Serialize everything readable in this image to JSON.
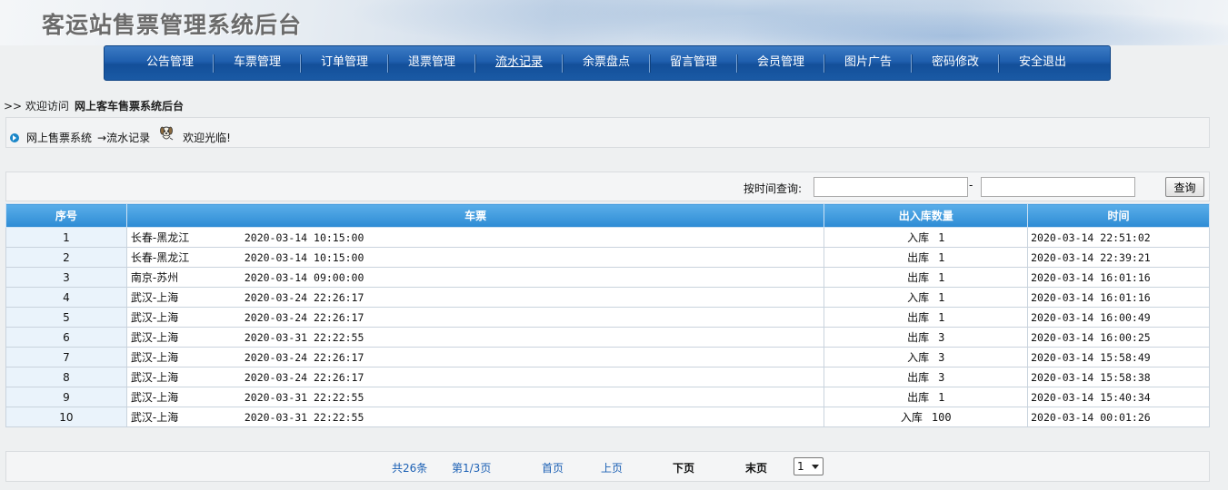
{
  "header": {
    "title": "客运站售票管理系统后台"
  },
  "nav": {
    "items": [
      {
        "label": "公告管理"
      },
      {
        "label": "车票管理"
      },
      {
        "label": "订单管理"
      },
      {
        "label": "退票管理"
      },
      {
        "label": "流水记录"
      },
      {
        "label": "余票盘点"
      },
      {
        "label": "留言管理"
      },
      {
        "label": "会员管理"
      },
      {
        "label": "图片广告"
      },
      {
        "label": "密码修改"
      },
      {
        "label": "安全退出"
      }
    ],
    "active_index": 4
  },
  "welcome": {
    "prefix": ">>  欢迎访问",
    "site_name": "网上客车售票系统后台"
  },
  "breadcrumb": {
    "home": "网上售票系统",
    "current": "→流水记录",
    "greeting": "欢迎光临!"
  },
  "search": {
    "label": "按时间查询:",
    "separator": "-",
    "start_value": "",
    "end_value": "",
    "button": "查询"
  },
  "table": {
    "headers": [
      "序号",
      "车票",
      "出入库数量",
      "时间"
    ],
    "rows": [
      {
        "no": "1",
        "route": "长春-黑龙江",
        "depart": "2020-03-14 10:15:00",
        "type": "入库",
        "qty": "1",
        "time": "2020-03-14 22:51:02"
      },
      {
        "no": "2",
        "route": "长春-黑龙江",
        "depart": "2020-03-14 10:15:00",
        "type": "出库",
        "qty": "1",
        "time": "2020-03-14 22:39:21"
      },
      {
        "no": "3",
        "route": "南京-苏州",
        "depart": "2020-03-14 09:00:00",
        "type": "出库",
        "qty": "1",
        "time": "2020-03-14 16:01:16"
      },
      {
        "no": "4",
        "route": "武汉-上海",
        "depart": "2020-03-24 22:26:17",
        "type": "入库",
        "qty": "1",
        "time": "2020-03-14 16:01:16"
      },
      {
        "no": "5",
        "route": "武汉-上海",
        "depart": "2020-03-24 22:26:17",
        "type": "出库",
        "qty": "1",
        "time": "2020-03-14 16:00:49"
      },
      {
        "no": "6",
        "route": "武汉-上海",
        "depart": "2020-03-31 22:22:55",
        "type": "出库",
        "qty": "3",
        "time": "2020-03-14 16:00:25"
      },
      {
        "no": "7",
        "route": "武汉-上海",
        "depart": "2020-03-24 22:26:17",
        "type": "入库",
        "qty": "3",
        "time": "2020-03-14 15:58:49"
      },
      {
        "no": "8",
        "route": "武汉-上海",
        "depart": "2020-03-24 22:26:17",
        "type": "出库",
        "qty": "3",
        "time": "2020-03-14 15:58:38"
      },
      {
        "no": "9",
        "route": "武汉-上海",
        "depart": "2020-03-31 22:22:55",
        "type": "出库",
        "qty": "1",
        "time": "2020-03-14 15:40:34"
      },
      {
        "no": "10",
        "route": "武汉-上海",
        "depart": "2020-03-31 22:22:55",
        "type": "入库",
        "qty": "100",
        "time": "2020-03-14 00:01:26"
      }
    ]
  },
  "pager": {
    "total": "共26条",
    "page_info": "第1/3页",
    "first": "首页",
    "prev": "上页",
    "next": "下页",
    "last": "末页",
    "selected_page": "1"
  }
}
